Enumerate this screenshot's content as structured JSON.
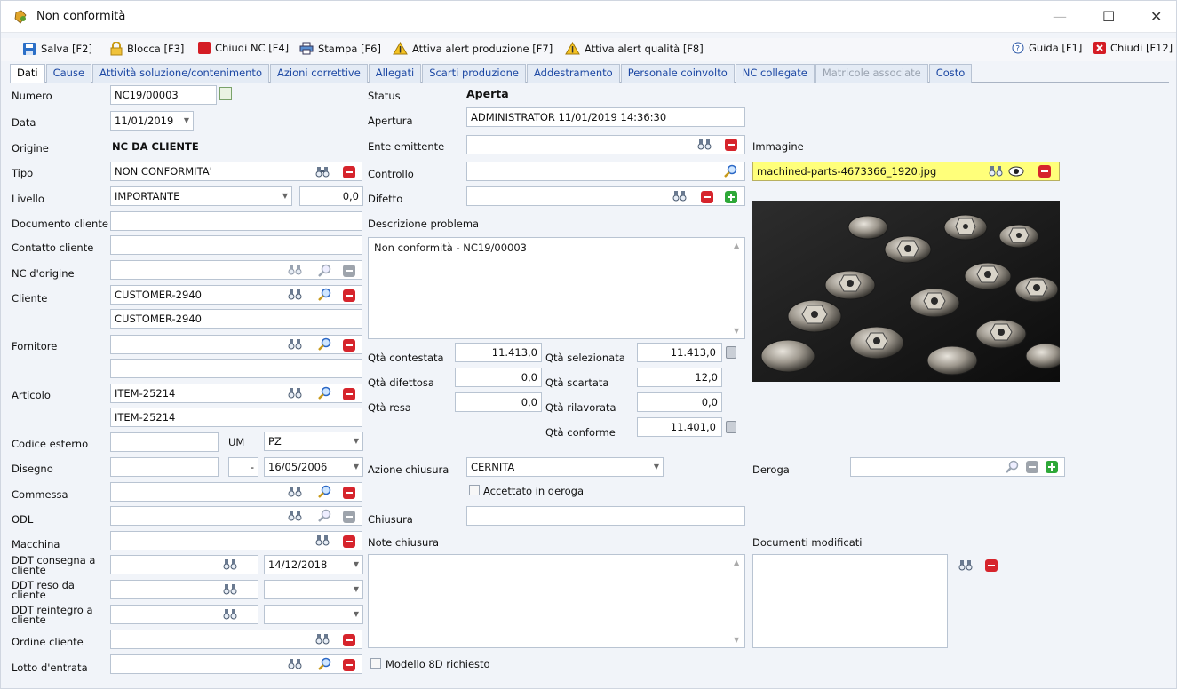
{
  "window": {
    "title": "Non conformità"
  },
  "toolbar": {
    "save": "Salva [F2]",
    "lock": "Blocca [F3]",
    "close_nc": "Chiudi NC [F4]",
    "print": "Stampa [F6]",
    "alert_prod": "Attiva alert produzione [F7]",
    "alert_quality": "Attiva alert qualità [F8]",
    "help": "Guida [F1]",
    "close": "Chiudi [F12]"
  },
  "tabs": [
    "Dati",
    "Cause",
    "Attività soluzione/contenimento",
    "Azioni correttive",
    "Allegati",
    "Scarti produzione",
    "Addestramento",
    "Personale coinvolto",
    "NC collegate",
    "Matricole associate",
    "Costo"
  ],
  "labels": {
    "numero": "Numero",
    "data": "Data",
    "origine": "Origine",
    "tipo": "Tipo",
    "livello": "Livello",
    "documento_cliente": "Documento cliente",
    "contatto_cliente": "Contatto cliente",
    "nc_origine": "NC d'origine",
    "cliente": "Cliente",
    "fornitore": "Fornitore",
    "articolo": "Articolo",
    "codice_esterno": "Codice esterno",
    "um": "UM",
    "disegno": "Disegno",
    "commessa": "Commessa",
    "odl": "ODL",
    "macchina": "Macchina",
    "ddt_consegna": "DDT consegna a cliente",
    "ddt_reso": "DDT reso da cliente",
    "ddt_reintegro": "DDT reintegro a cliente",
    "ordine_cliente": "Ordine cliente",
    "lotto_entrata": "Lotto d'entrata",
    "status": "Status",
    "apertura": "Apertura",
    "ente_emittente": "Ente emittente",
    "controllo": "Controllo",
    "difetto": "Difetto",
    "descrizione_problema": "Descrizione problema",
    "qta_contestata": "Qtà contestata",
    "qta_difettosa": "Qtà difettosa",
    "qta_resa": "Qtà resa",
    "qta_selezionata": "Qtà selezionata",
    "qta_scartata": "Qtà scartata",
    "qta_rilavorata": "Qtà rilavorata",
    "qta_conforme": "Qtà conforme",
    "azione_chiusura": "Azione chiusura",
    "accettato_deroga": "Accettato in deroga",
    "chiusura": "Chiusura",
    "note_chiusura": "Note chiusura",
    "modello_8d": "Modello 8D richiesto",
    "immagine": "Immagine",
    "deroga": "Deroga",
    "documenti_modificati": "Documenti modificati"
  },
  "values": {
    "numero": "NC19/00003",
    "data": "11/01/2019",
    "origine": "NC DA CLIENTE",
    "tipo": "NON CONFORMITA'",
    "livello": "IMPORTANTE",
    "livello_num": "0,0",
    "cliente_code": "CUSTOMER-2940",
    "cliente_name": "CUSTOMER-2940",
    "articolo_code": "ITEM-25214",
    "articolo_name": "ITEM-25214",
    "um": "PZ",
    "disegno_sep": "-",
    "disegno_date": "16/05/2006",
    "ddt_consegna_date": "14/12/2018",
    "status": "Aperta",
    "apertura": "ADMINISTRATOR 11/01/2019 14:36:30",
    "descrizione": "Non conformità - NC19/00003",
    "qta_contestata": "11.413,0",
    "qta_difettosa": "0,0",
    "qta_resa": "0,0",
    "qta_selezionata": "11.413,0",
    "qta_scartata": "12,0",
    "qta_rilavorata": "0,0",
    "qta_conforme": "11.401,0",
    "azione_chiusura": "CERNITA",
    "immagine_file": "machined-parts-4673366_1920.jpg"
  },
  "colors": {
    "accent": "#1b47a3",
    "remove": "#d6242c",
    "add": "#2ea838",
    "highlight": "#ffff7a"
  }
}
